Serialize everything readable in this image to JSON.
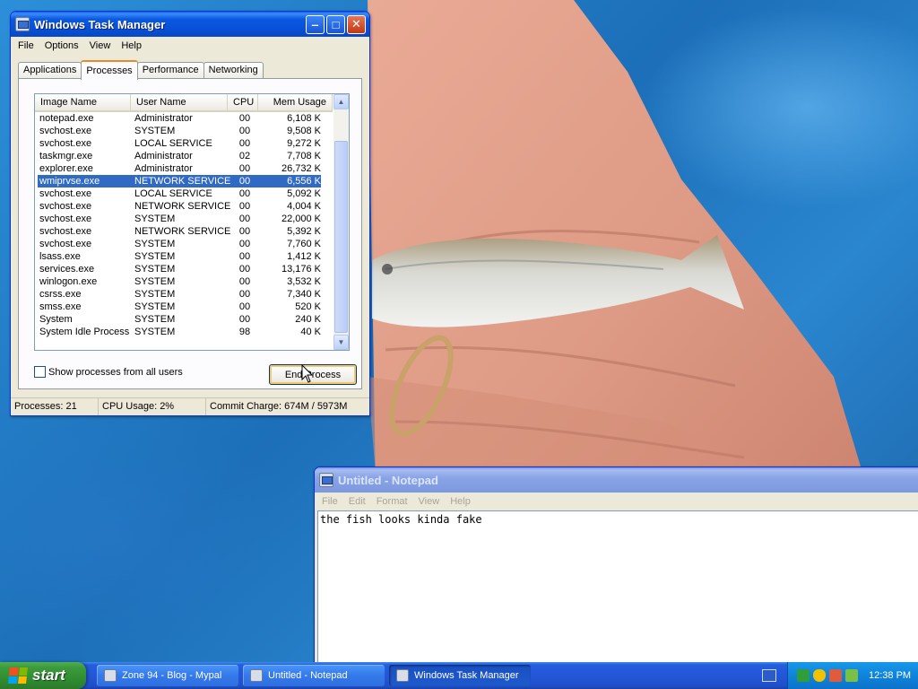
{
  "desktop": {
    "wallpaper": "photo of a small silver fish held in a hand"
  },
  "task_manager": {
    "title": "Windows Task Manager",
    "menu": [
      "File",
      "Options",
      "View",
      "Help"
    ],
    "tabs": [
      "Applications",
      "Processes",
      "Performance",
      "Networking"
    ],
    "active_tab": "Processes",
    "columns": [
      "Image Name",
      "User Name",
      "CPU",
      "Mem Usage"
    ],
    "processes": [
      {
        "name": "notepad.exe",
        "user": "Administrator",
        "cpu": "00",
        "mem": "6,108 K"
      },
      {
        "name": "svchost.exe",
        "user": "SYSTEM",
        "cpu": "00",
        "mem": "9,508 K"
      },
      {
        "name": "svchost.exe",
        "user": "LOCAL SERVICE",
        "cpu": "00",
        "mem": "9,272 K"
      },
      {
        "name": "taskmgr.exe",
        "user": "Administrator",
        "cpu": "02",
        "mem": "7,708 K"
      },
      {
        "name": "explorer.exe",
        "user": "Administrator",
        "cpu": "00",
        "mem": "26,732 K"
      },
      {
        "name": "wmiprvse.exe",
        "user": "NETWORK SERVICE",
        "cpu": "00",
        "mem": "6,556 K",
        "selected": true
      },
      {
        "name": "svchost.exe",
        "user": "LOCAL SERVICE",
        "cpu": "00",
        "mem": "5,092 K"
      },
      {
        "name": "svchost.exe",
        "user": "NETWORK SERVICE",
        "cpu": "00",
        "mem": "4,004 K"
      },
      {
        "name": "svchost.exe",
        "user": "SYSTEM",
        "cpu": "00",
        "mem": "22,000 K"
      },
      {
        "name": "svchost.exe",
        "user": "NETWORK SERVICE",
        "cpu": "00",
        "mem": "5,392 K"
      },
      {
        "name": "svchost.exe",
        "user": "SYSTEM",
        "cpu": "00",
        "mem": "7,760 K"
      },
      {
        "name": "lsass.exe",
        "user": "SYSTEM",
        "cpu": "00",
        "mem": "1,412 K"
      },
      {
        "name": "services.exe",
        "user": "SYSTEM",
        "cpu": "00",
        "mem": "13,176 K"
      },
      {
        "name": "winlogon.exe",
        "user": "SYSTEM",
        "cpu": "00",
        "mem": "3,532 K"
      },
      {
        "name": "csrss.exe",
        "user": "SYSTEM",
        "cpu": "00",
        "mem": "7,340 K"
      },
      {
        "name": "smss.exe",
        "user": "SYSTEM",
        "cpu": "00",
        "mem": "520 K"
      },
      {
        "name": "System",
        "user": "SYSTEM",
        "cpu": "00",
        "mem": "240 K"
      },
      {
        "name": "System Idle Process",
        "user": "SYSTEM",
        "cpu": "98",
        "mem": "40 K"
      }
    ],
    "show_all_label": "Show processes from all users",
    "show_all_checked": false,
    "end_process_label": "End Process",
    "status": {
      "processes": "Processes: 21",
      "cpu": "CPU Usage: 2%",
      "commit": "Commit Charge: 674M / 5973M"
    }
  },
  "notepad": {
    "title": "Untitled - Notepad",
    "menu": [
      "File",
      "Edit",
      "Format",
      "View",
      "Help"
    ],
    "text": "the fish looks kinda fake"
  },
  "taskbar": {
    "start_label": "start",
    "buttons": [
      {
        "label": "Zone 94 - Blog - Mypal",
        "icon": "browser-icon",
        "active": false
      },
      {
        "label": "Untitled - Notepad",
        "icon": "notepad-icon",
        "active": false
      },
      {
        "label": "Windows Task Manager",
        "icon": "taskmgr-icon",
        "active": true
      }
    ],
    "clock": "12:38 PM"
  },
  "colors": {
    "selection": "#316ac5",
    "titlebar_active": "#0650d6",
    "taskbar": "#2456d8",
    "start_green": "#3c9a3c"
  }
}
